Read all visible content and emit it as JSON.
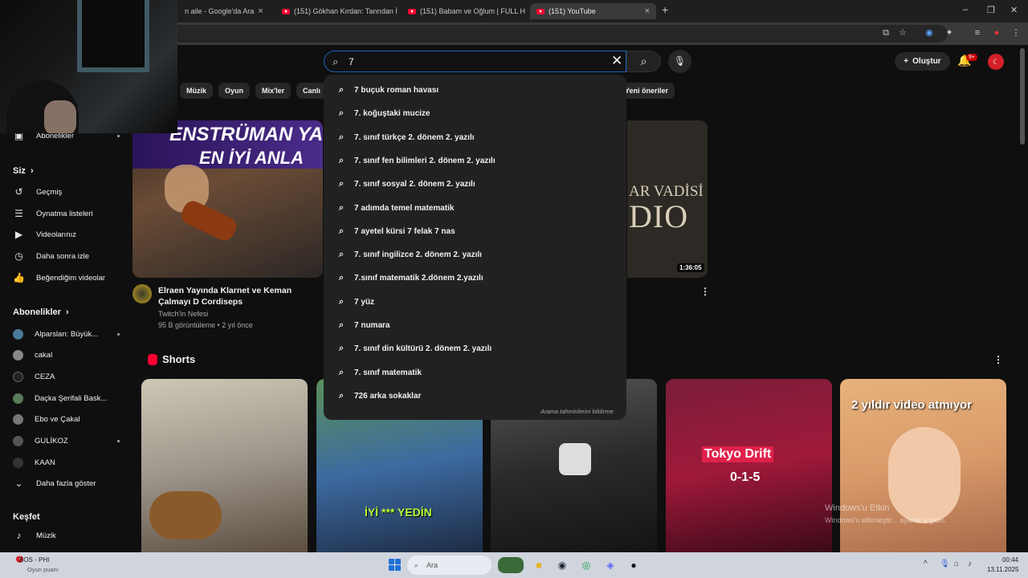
{
  "browser": {
    "tabs": [
      {
        "label": "n aile - Google'da Ara"
      },
      {
        "label": "(151) Gökhan Kırdan: Tanrıdan İ"
      },
      {
        "label": "(151) Babam ve Oğlum | FULL H"
      },
      {
        "label": "(151) YouTube"
      }
    ],
    "new_tab": "+",
    "close": "×"
  },
  "search": {
    "query": "7",
    "suggestions": [
      "7 buçuk roman havası",
      "7. koğuştaki mucize",
      "7. sınıf türkçe 2. dönem 2. yazılı",
      "7. sınıf fen bilimleri 2. dönem 2. yazılı",
      "7. sınıf sosyal 2. dönem 2. yazılı",
      "7 adımda temel matematik",
      "7 ayetel kürsi 7 felak 7 nas",
      "7. sınıf ingilizce 2. dönem 2. yazılı",
      "7.sınıf matematik 2.dönem 2.yazılı",
      "7 yüz",
      "7 numara",
      "7. sınıf din kültürü 2. dönem 2. yazılı",
      "7. sınıf matematik",
      "726 arka sokaklar"
    ],
    "report_label": "Arama tahminlerini bildirme"
  },
  "header": {
    "create_label": "Oluştur",
    "notif_count": "9+"
  },
  "chips": [
    "Müzik",
    "Oyun",
    "Mix'ler",
    "Canlı",
    "Yeni öneriler"
  ],
  "sidebar": {
    "subs_top": "Abonelikler",
    "you_label": "Siz",
    "you_items": [
      "Geçmiş",
      "Oynatma listeleri",
      "Videolarınız",
      "Daha sonra izle",
      "Beğendiğim videolar"
    ],
    "subs_heading": "Abonelikler",
    "channels": [
      "Alparslan: Büyük...",
      "cakal",
      "CEZA",
      "Daçka Şerifali Bask...",
      "Ebo ve Çakal",
      "GULİKOZ",
      "KAAN"
    ],
    "show_more": "Daha fazla göster",
    "explore_heading": "Keşfet",
    "explore_items": [
      "Müzik"
    ]
  },
  "video1": {
    "thumb_line1": "ENSTRÜMAN YA",
    "thumb_line2": "EN İYİ ANLA",
    "title": "Elraen Yayında Klarnet ve Keman Çalmayı D Cordiseps",
    "channel": "Twitch'in Nefesi",
    "meta": "95 B görüntüleme • 2 yıl önce"
  },
  "video2": {
    "thumb_line1": "AR VADİSİ",
    "thumb_line2": "DIO",
    "duration": "1:36:05"
  },
  "shorts": {
    "heading": "Shorts",
    "s2_caption": "İYİ *** YEDİN",
    "s4_line1": "Tokyo Drift",
    "s4_line2": "0-1-5",
    "s5_caption": "2 yıldır video atmıyor"
  },
  "windows_activation": {
    "line1": "Windows'u Etkin",
    "line2": "Windows'u etkinleştir... ayarlar'a gidin."
  },
  "taskbar": {
    "weather_title": "BOS - PHI",
    "weather_sub": "Oyun puanı",
    "weather_badge": "7",
    "search_placeholder": "Ara",
    "time": "00:44",
    "date": "13.11.2025"
  }
}
